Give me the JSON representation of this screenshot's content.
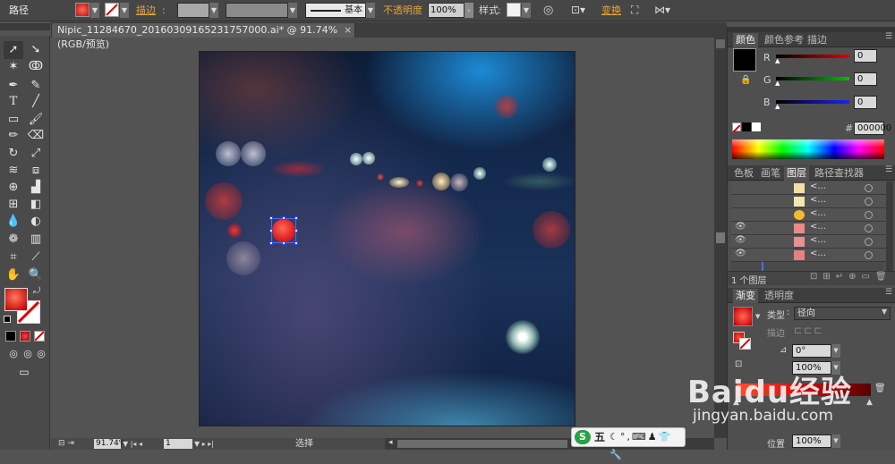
{
  "controlbar": {
    "title": "路径",
    "stroke_label": "描边",
    "stroke_value": "",
    "brush_label": "基本",
    "opacity_label": "不透明度",
    "opacity_value": "100%",
    "style_label": "样式",
    "transform_label": "变换"
  },
  "document": {
    "tab_title": "Nipic_11284670_20160309165231757000.ai* @ 91.74% (RGB/预览)",
    "close": "×"
  },
  "color_panel": {
    "tabs": [
      "颜色",
      "颜色参考",
      "描边"
    ],
    "r_label": "R",
    "r_value": "0",
    "g_label": "G",
    "g_value": "0",
    "b_label": "B",
    "b_value": "0",
    "hash": "#",
    "hex_value": "000000",
    "colors": {
      "red": "#cc0000",
      "green": "#00aa00",
      "blue": "#0000cc"
    }
  },
  "layers_panel": {
    "tabs": [
      "色板",
      "画笔",
      "图层",
      "路径查找器"
    ],
    "rows": [
      {
        "label": "<...",
        "swatch": "#f4dfa8",
        "eye": false
      },
      {
        "label": "<...",
        "swatch": "#f6e4b0",
        "eye": false
      },
      {
        "label": "<...",
        "swatch": "#f5b932",
        "eye": false
      },
      {
        "label": "<...",
        "swatch": "#e98a8a",
        "eye": true
      },
      {
        "label": "<...",
        "swatch": "#e99090",
        "eye": true
      },
      {
        "label": "<...",
        "swatch": "#e97f85",
        "eye": true
      }
    ],
    "footer": "1 个图层"
  },
  "gradient_panel": {
    "tabs": [
      "渐变",
      "透明度"
    ],
    "type_label": "类型",
    "type_value": "径向",
    "stroke_label": "描边",
    "angle_value": "0°",
    "ratio_value": "100%",
    "position_label": "位置",
    "position_value": "100%"
  },
  "statusbar": {
    "zoom": "91.74%",
    "page": "1",
    "mode": "选择"
  },
  "ime": {
    "logo": "S",
    "label": "五"
  },
  "watermark": {
    "brand": "Baidu经验",
    "url": "jingyan.baidu.com"
  }
}
